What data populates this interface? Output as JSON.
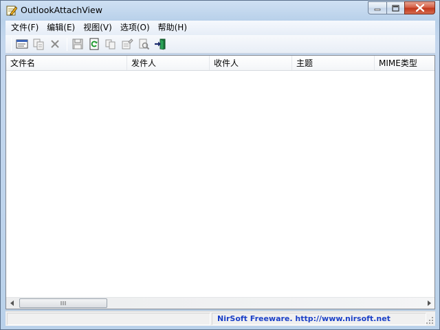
{
  "window": {
    "title": "OutlookAttachView",
    "app_icon": "pencil-paper-icon"
  },
  "menu": [
    "文件(F)",
    "编辑(E)",
    "视图(V)",
    "选项(O)",
    "帮助(H)"
  ],
  "toolbar": {
    "buttons": [
      {
        "icon": "properties-window-icon",
        "enabled": true
      },
      {
        "icon": "copy-items-icon",
        "enabled": false
      },
      {
        "icon": "delete-x-icon",
        "enabled": false
      },
      {
        "icon": "save-floppy-icon",
        "enabled": false
      },
      {
        "icon": "refresh-icon",
        "enabled": true
      },
      {
        "icon": "copy-icon",
        "enabled": false
      },
      {
        "icon": "properties-icon",
        "enabled": false
      },
      {
        "icon": "find-icon",
        "enabled": false
      },
      {
        "icon": "exit-icon",
        "enabled": true
      }
    ]
  },
  "list": {
    "columns": [
      "文件名",
      "发件人",
      "收件人",
      "主题",
      "MIME类型"
    ],
    "rows": []
  },
  "statusbar": {
    "pane1": "",
    "link": "NirSoft Freeware.  http://www.nirsoft.net"
  },
  "colors": {
    "title_bar": "#c4d7ee",
    "close_button": "#c0351a",
    "status_link": "#1a3fc7"
  }
}
